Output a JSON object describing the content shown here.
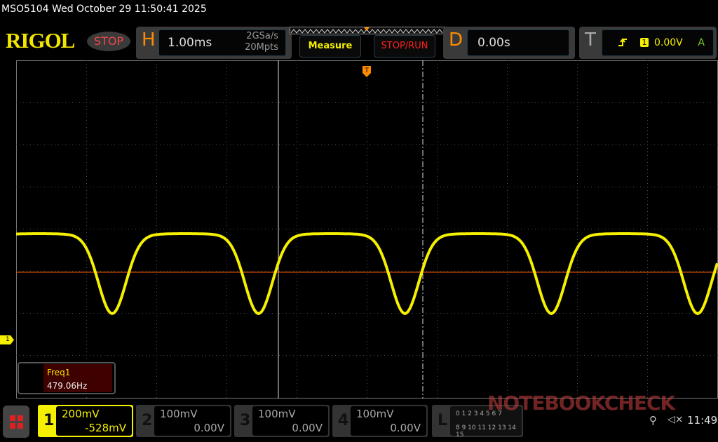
{
  "header": {
    "title": "MSO5104  Wed October 29 11:50:41 2025",
    "logo": "RIGOL",
    "run_state": "STOP"
  },
  "horizontal": {
    "label": "H",
    "timebase": "1.00ms",
    "sample_rate": "2GSa/s",
    "memory_depth": "20Mpts"
  },
  "buttons": {
    "measure": "Measure",
    "stop_run": "STOP/RUN"
  },
  "delay": {
    "label": "D",
    "value": "0.00s"
  },
  "trigger": {
    "label": "T",
    "edge_icon": "rising-edge-icon",
    "source": "1",
    "level": "0.00V",
    "mode": "A"
  },
  "channels": [
    {
      "num": "1",
      "scale": "200mV",
      "offset": "-528mV",
      "color": "#f5f000",
      "active": true
    },
    {
      "num": "2",
      "scale": "100mV",
      "offset": "0.00V",
      "active": false
    },
    {
      "num": "3",
      "scale": "100mV",
      "offset": "0.00V",
      "active": false
    },
    {
      "num": "4",
      "scale": "100mV",
      "offset": "0.00V",
      "active": false
    }
  ],
  "logic": {
    "label": "L",
    "row1": "0 1 2 3  4 5 6 7",
    "row2": "8 9 10 11 12 13 14 15"
  },
  "measurement": {
    "name": "Freq1",
    "value": "479.06Hz"
  },
  "channel_marker": "1",
  "status": {
    "time": "11:49",
    "usb_icon": "usb-icon",
    "mute_icon": "speaker-muted-icon"
  },
  "watermark": "NOTEBOOKCHECK",
  "colors": {
    "ch1": "#f5f000",
    "trigger_level": "#ff5a00",
    "accent": "#ff8c00"
  }
}
